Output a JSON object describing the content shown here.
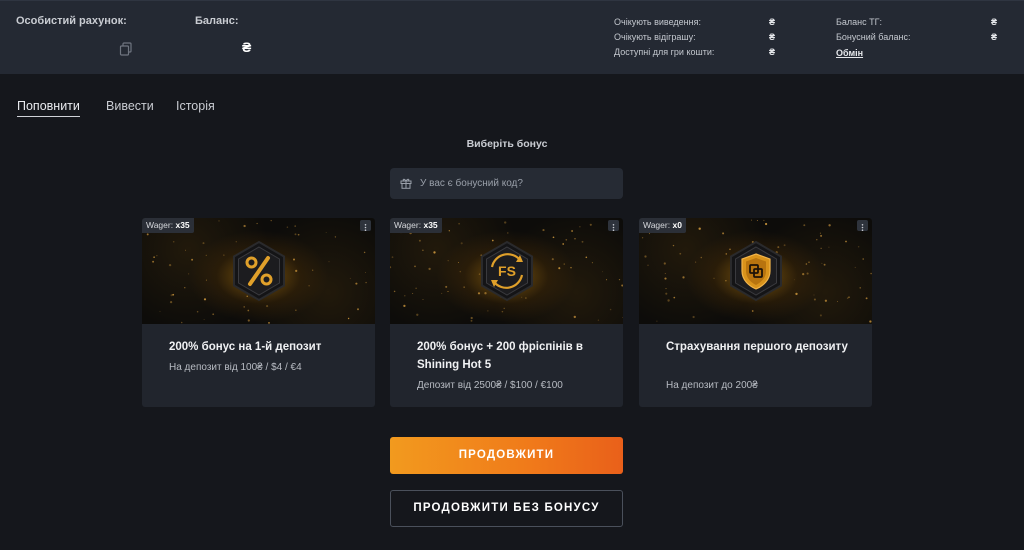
{
  "account": {
    "personal_account_label": "Особистий рахунок:",
    "balance_label": "Баланс:",
    "balance_currency": "₴",
    "stats_left": [
      {
        "label": "Очікують виведення:",
        "currency": "₴"
      },
      {
        "label": "Очікують відіграшу:",
        "currency": "₴"
      },
      {
        "label": "Доступні для гри кошти:",
        "currency": "₴"
      }
    ],
    "stats_right": [
      {
        "label": "Баланс ТГ:",
        "currency": "₴"
      },
      {
        "label": "Бонусний баланс:",
        "currency": "₴"
      }
    ],
    "exchange_link": "Обмін"
  },
  "tabs": [
    {
      "label": "Поповнити",
      "active": true
    },
    {
      "label": "Вивести",
      "active": false
    },
    {
      "label": "Історія",
      "active": false
    }
  ],
  "bonus": {
    "title": "Виберіть бонус",
    "promo_placeholder": "У вас є бонусний код?",
    "promo_icon": "gift-icon",
    "wager_label": "Wager:",
    "cards": [
      {
        "wager": "x35",
        "icon": "percent-hexagon-icon",
        "title": "200% бонус на 1-й депозит",
        "subtitle": "На депозит від 100₴ / $4 / €4"
      },
      {
        "wager": "x35",
        "icon": "free-spins-hexagon-icon",
        "title": "200% бонус + 200 фріспінів в Shining Hot 5",
        "subtitle": "Депозит від 2500₴ / $100 / €100"
      },
      {
        "wager": "x0",
        "icon": "shield-hexagon-icon",
        "title": "Страхування першого депозиту",
        "subtitle": "На депозит до 200₴"
      }
    ]
  },
  "actions": {
    "continue_label": "ПРОДОВЖИТИ",
    "continue_without_bonus_label": "ПРОДОВЖИТИ БЕЗ БОНУСУ"
  },
  "colors": {
    "background": "#15171c",
    "topbar": "#242933",
    "card": "#21252d",
    "accent_orange": "#f07a1a",
    "gold": "#d9931b"
  }
}
